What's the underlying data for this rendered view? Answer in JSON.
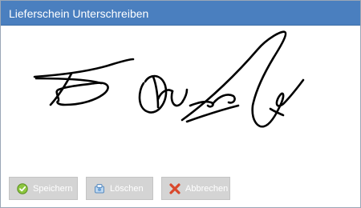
{
  "dialog": {
    "title": "Lieferschein Unterschreiben"
  },
  "buttons": {
    "save_label": "Speichern",
    "clear_label": "Löschen",
    "cancel_label": "Abbrechen"
  },
  "icons": {
    "save": "check-circle-icon",
    "clear": "eraser-icon",
    "cancel": "red-x-icon"
  },
  "colors": {
    "titlebar": "#4a7fbf",
    "button_bg": "#d4d4d4",
    "ink": "#000000"
  }
}
